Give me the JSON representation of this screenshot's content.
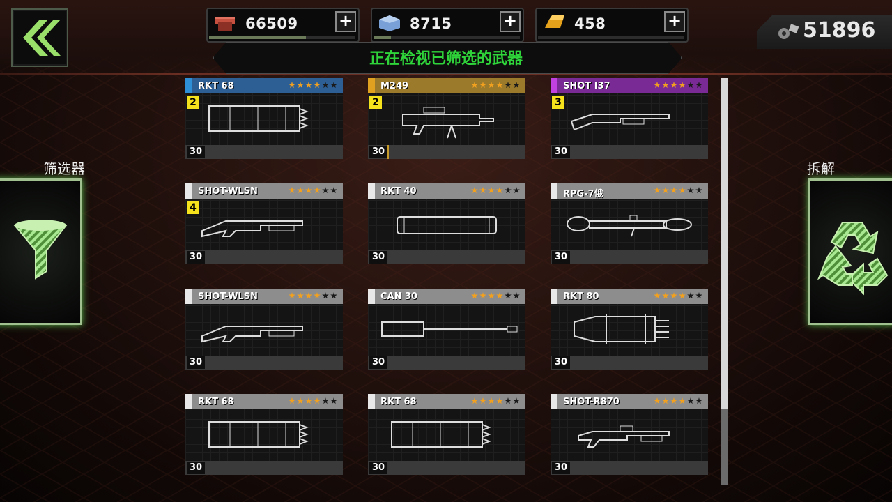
{
  "status_banner": "正在检视已筛选的武器",
  "gear_count": "51896",
  "currencies": [
    {
      "name": "red-supply-icon",
      "value": "66509",
      "color": "#b3453a",
      "bar_fraction": 0.66
    },
    {
      "name": "blue-supply-icon",
      "value": "8715",
      "color": "#6a8fc8",
      "bar_fraction": 0.12
    },
    {
      "name": "gold-bar-icon",
      "value": "458",
      "color": "#f2a11f",
      "bar_fraction": 0.0
    }
  ],
  "side": {
    "filter_label": "筛选器",
    "dismantle_label": "拆解",
    "accent": "#5ab54a"
  },
  "weapons": [
    {
      "name": "RKT 68",
      "stars": 4,
      "stripe": "#2f8fd6",
      "head": "#2d5f94",
      "badge": "2",
      "level": "30",
      "icon": "rocket-pod",
      "progress": 0
    },
    {
      "name": "M249",
      "stars": 4,
      "stripe": "#e0a020",
      "head": "#9b7a2c",
      "badge": "2",
      "level": "30",
      "icon": "machine-gun",
      "progress": 0.01
    },
    {
      "name": "SHOT I37",
      "stars": 4,
      "stripe": "#c040e0",
      "head": "#7a2a94",
      "badge": "3",
      "level": "30",
      "icon": "pump-shotgun",
      "progress": 0
    },
    {
      "name": "SHOT-WLSN",
      "stars": 4,
      "stripe": "#e8e8e8",
      "head": "#8d8d8d",
      "badge": "4",
      "level": "30",
      "icon": "shotgun",
      "progress": 0
    },
    {
      "name": "RKT 40",
      "stars": 4,
      "stripe": "#e8e8e8",
      "head": "#8d8d8d",
      "badge": "",
      "level": "30",
      "icon": "rocket-tube",
      "progress": 0
    },
    {
      "name": "RPG-7俄",
      "stars": 4,
      "stripe": "#e8e8e8",
      "head": "#8d8d8d",
      "badge": "",
      "level": "30",
      "icon": "rpg",
      "progress": 0
    },
    {
      "name": "SHOT-WLSN",
      "stars": 4,
      "stripe": "#e8e8e8",
      "head": "#8d8d8d",
      "badge": "",
      "level": "30",
      "icon": "shotgun",
      "progress": 0
    },
    {
      "name": "CAN 30",
      "stars": 4,
      "stripe": "#e8e8e8",
      "head": "#8d8d8d",
      "badge": "",
      "level": "30",
      "icon": "autocannon",
      "progress": 0
    },
    {
      "name": "RKT 80",
      "stars": 4,
      "stripe": "#e8e8e8",
      "head": "#8d8d8d",
      "badge": "",
      "level": "30",
      "icon": "rocket-pod-large",
      "progress": 0
    },
    {
      "name": "RKT 68",
      "stars": 4,
      "stripe": "#e8e8e8",
      "head": "#8d8d8d",
      "badge": "",
      "level": "30",
      "icon": "rocket-pod",
      "progress": 0
    },
    {
      "name": "RKT 68",
      "stars": 4,
      "stripe": "#e8e8e8",
      "head": "#8d8d8d",
      "badge": "",
      "level": "30",
      "icon": "rocket-pod",
      "progress": 0
    },
    {
      "name": "SHOT-R870",
      "stars": 4,
      "stripe": "#e8e8e8",
      "head": "#8d8d8d",
      "badge": "",
      "level": "30",
      "icon": "tactical-shotgun",
      "progress": 0
    }
  ]
}
